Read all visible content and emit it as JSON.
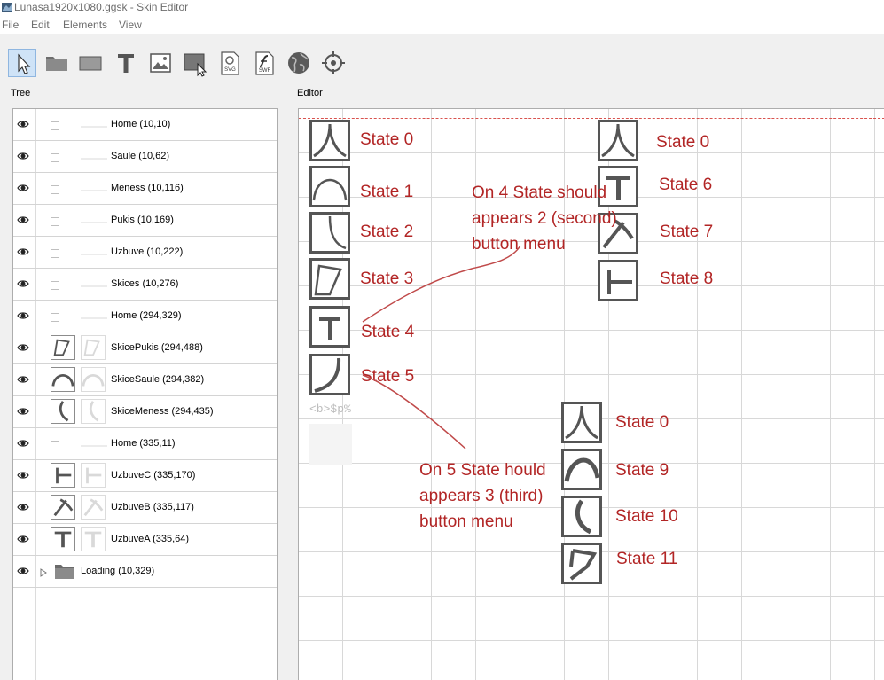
{
  "window": {
    "title": "Lunasa1920x1080.ggsk - Skin Editor"
  },
  "menu": {
    "items": [
      "File",
      "Edit",
      "Elements",
      "View"
    ]
  },
  "toolbar": {
    "tools": [
      "pointer-tool",
      "container-tool",
      "rectangle-tool",
      "text-tool",
      "image-tool",
      "button-tool",
      "svg-tool",
      "swf-tool",
      "map-tool",
      "hotspot-tool"
    ],
    "svg_label": "SVG",
    "swf_label": "SWF"
  },
  "tree": {
    "label": "Tree",
    "rows": [
      {
        "label": "Home (10,10)",
        "kind": "plain"
      },
      {
        "label": "Saule (10,62)",
        "kind": "plain"
      },
      {
        "label": "Meness (10,116)",
        "kind": "plain"
      },
      {
        "label": "Pukis (10,169)",
        "kind": "plain"
      },
      {
        "label": "Uzbuve (10,222)",
        "kind": "plain"
      },
      {
        "label": "Skices (10,276)",
        "kind": "plain"
      },
      {
        "label": "Home (294,329)",
        "kind": "plain"
      },
      {
        "label": "SkicePukis (294,488)",
        "kind": "thumb",
        "icon": "pukis"
      },
      {
        "label": "SkiceSaule (294,382)",
        "kind": "thumb",
        "icon": "saule"
      },
      {
        "label": "SkiceMeness (294,435)",
        "kind": "thumb",
        "icon": "meness"
      },
      {
        "label": "Home (335,11)",
        "kind": "plain"
      },
      {
        "label": "UzbuveC (335,170)",
        "kind": "thumb",
        "icon": "uzbuveC"
      },
      {
        "label": "UzbuveB (335,117)",
        "kind": "thumb",
        "icon": "uzbuveB"
      },
      {
        "label": "UzbuveA (335,64)",
        "kind": "thumb",
        "icon": "uzbuveA"
      },
      {
        "label": "Loading (10,329)",
        "kind": "folder"
      }
    ]
  },
  "editor": {
    "label": "Editor",
    "placeholder_text": "<b>$p%",
    "states_left": [
      "State 0",
      "State 1",
      "State 2",
      "State 3",
      "State 4",
      "State 5"
    ],
    "states_right": [
      "State 0",
      "State 6",
      "State 7",
      "State 8"
    ],
    "states_bottom": [
      "State 0",
      "State 9",
      "State 10",
      "State 11"
    ],
    "note1": "On 4 State should\nappears 2 (second)\nbutton menu",
    "note2": "On 5 State hould\nappears 3 (third)\nbutton menu"
  },
  "colors": {
    "annotation": "#b22525",
    "guide": "#d9534f",
    "button_border": "#555555",
    "active_tool": "#cfe3f7"
  }
}
